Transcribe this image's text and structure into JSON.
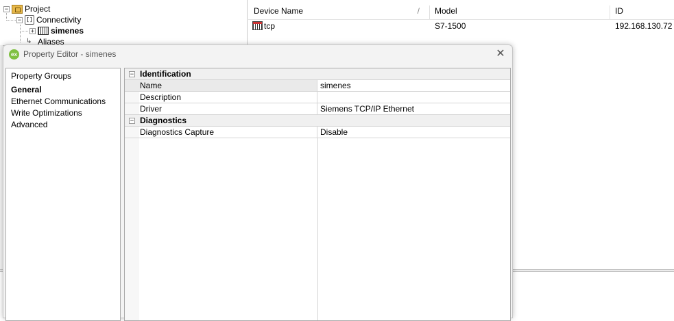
{
  "tree": {
    "project": "Project",
    "connectivity": "Connectivity",
    "device": "simenes",
    "aliases": "Aliases"
  },
  "list": {
    "columns": [
      "Device Name",
      "Model",
      "ID"
    ],
    "rows": [
      {
        "name": "tcp",
        "model": "S7-1500",
        "id": "192.168.130.72"
      }
    ]
  },
  "dialog": {
    "title": "Property Editor - simenes",
    "app_icon_text": "ex",
    "groups": [
      "Property Groups",
      "General",
      "Ethernet Communications",
      "Write Optimizations",
      "Advanced"
    ],
    "selected_group": "General",
    "categories": [
      {
        "title": "Identification",
        "rows": [
          {
            "name": "Name",
            "value": "simenes"
          },
          {
            "name": "Description",
            "value": ""
          },
          {
            "name": "Driver",
            "value": "Siemens TCP/IP Ethernet"
          }
        ]
      },
      {
        "title": "Diagnostics",
        "rows": [
          {
            "name": "Diagnostics Capture",
            "value": "Disable"
          }
        ]
      }
    ]
  },
  "icons": {
    "collapse": "⊟",
    "expand": "⊞",
    "close": "✕",
    "sort": "/"
  }
}
